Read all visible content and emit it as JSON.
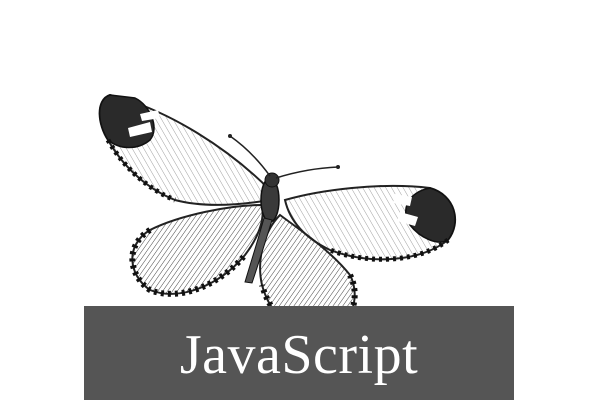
{
  "cover": {
    "title": "JavaScript",
    "band_color": "#555555",
    "title_color": "#ffffff",
    "illustration": "butterfly-engraving-icon"
  }
}
